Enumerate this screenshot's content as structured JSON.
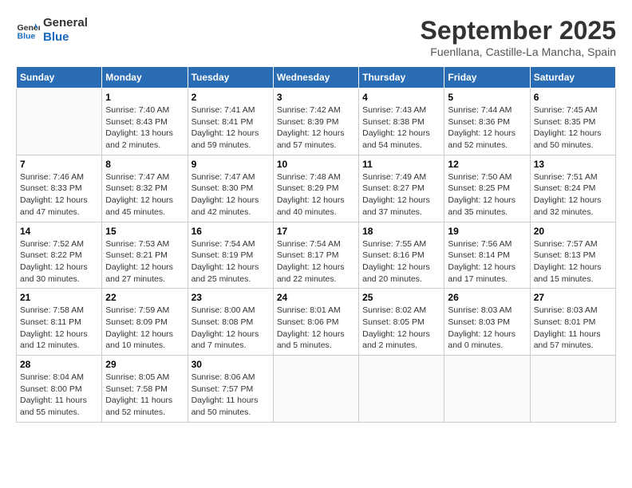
{
  "header": {
    "logo_line1": "General",
    "logo_line2": "Blue",
    "month": "September 2025",
    "location": "Fuenllana, Castille-La Mancha, Spain"
  },
  "weekdays": [
    "Sunday",
    "Monday",
    "Tuesday",
    "Wednesday",
    "Thursday",
    "Friday",
    "Saturday"
  ],
  "weeks": [
    [
      {
        "day": "",
        "info": ""
      },
      {
        "day": "1",
        "info": "Sunrise: 7:40 AM\nSunset: 8:43 PM\nDaylight: 13 hours\nand 2 minutes."
      },
      {
        "day": "2",
        "info": "Sunrise: 7:41 AM\nSunset: 8:41 PM\nDaylight: 12 hours\nand 59 minutes."
      },
      {
        "day": "3",
        "info": "Sunrise: 7:42 AM\nSunset: 8:39 PM\nDaylight: 12 hours\nand 57 minutes."
      },
      {
        "day": "4",
        "info": "Sunrise: 7:43 AM\nSunset: 8:38 PM\nDaylight: 12 hours\nand 54 minutes."
      },
      {
        "day": "5",
        "info": "Sunrise: 7:44 AM\nSunset: 8:36 PM\nDaylight: 12 hours\nand 52 minutes."
      },
      {
        "day": "6",
        "info": "Sunrise: 7:45 AM\nSunset: 8:35 PM\nDaylight: 12 hours\nand 50 minutes."
      }
    ],
    [
      {
        "day": "7",
        "info": "Sunrise: 7:46 AM\nSunset: 8:33 PM\nDaylight: 12 hours\nand 47 minutes."
      },
      {
        "day": "8",
        "info": "Sunrise: 7:47 AM\nSunset: 8:32 PM\nDaylight: 12 hours\nand 45 minutes."
      },
      {
        "day": "9",
        "info": "Sunrise: 7:47 AM\nSunset: 8:30 PM\nDaylight: 12 hours\nand 42 minutes."
      },
      {
        "day": "10",
        "info": "Sunrise: 7:48 AM\nSunset: 8:29 PM\nDaylight: 12 hours\nand 40 minutes."
      },
      {
        "day": "11",
        "info": "Sunrise: 7:49 AM\nSunset: 8:27 PM\nDaylight: 12 hours\nand 37 minutes."
      },
      {
        "day": "12",
        "info": "Sunrise: 7:50 AM\nSunset: 8:25 PM\nDaylight: 12 hours\nand 35 minutes."
      },
      {
        "day": "13",
        "info": "Sunrise: 7:51 AM\nSunset: 8:24 PM\nDaylight: 12 hours\nand 32 minutes."
      }
    ],
    [
      {
        "day": "14",
        "info": "Sunrise: 7:52 AM\nSunset: 8:22 PM\nDaylight: 12 hours\nand 30 minutes."
      },
      {
        "day": "15",
        "info": "Sunrise: 7:53 AM\nSunset: 8:21 PM\nDaylight: 12 hours\nand 27 minutes."
      },
      {
        "day": "16",
        "info": "Sunrise: 7:54 AM\nSunset: 8:19 PM\nDaylight: 12 hours\nand 25 minutes."
      },
      {
        "day": "17",
        "info": "Sunrise: 7:54 AM\nSunset: 8:17 PM\nDaylight: 12 hours\nand 22 minutes."
      },
      {
        "day": "18",
        "info": "Sunrise: 7:55 AM\nSunset: 8:16 PM\nDaylight: 12 hours\nand 20 minutes."
      },
      {
        "day": "19",
        "info": "Sunrise: 7:56 AM\nSunset: 8:14 PM\nDaylight: 12 hours\nand 17 minutes."
      },
      {
        "day": "20",
        "info": "Sunrise: 7:57 AM\nSunset: 8:13 PM\nDaylight: 12 hours\nand 15 minutes."
      }
    ],
    [
      {
        "day": "21",
        "info": "Sunrise: 7:58 AM\nSunset: 8:11 PM\nDaylight: 12 hours\nand 12 minutes."
      },
      {
        "day": "22",
        "info": "Sunrise: 7:59 AM\nSunset: 8:09 PM\nDaylight: 12 hours\nand 10 minutes."
      },
      {
        "day": "23",
        "info": "Sunrise: 8:00 AM\nSunset: 8:08 PM\nDaylight: 12 hours\nand 7 minutes."
      },
      {
        "day": "24",
        "info": "Sunrise: 8:01 AM\nSunset: 8:06 PM\nDaylight: 12 hours\nand 5 minutes."
      },
      {
        "day": "25",
        "info": "Sunrise: 8:02 AM\nSunset: 8:05 PM\nDaylight: 12 hours\nand 2 minutes."
      },
      {
        "day": "26",
        "info": "Sunrise: 8:03 AM\nSunset: 8:03 PM\nDaylight: 12 hours\nand 0 minutes."
      },
      {
        "day": "27",
        "info": "Sunrise: 8:03 AM\nSunset: 8:01 PM\nDaylight: 11 hours\nand 57 minutes."
      }
    ],
    [
      {
        "day": "28",
        "info": "Sunrise: 8:04 AM\nSunset: 8:00 PM\nDaylight: 11 hours\nand 55 minutes."
      },
      {
        "day": "29",
        "info": "Sunrise: 8:05 AM\nSunset: 7:58 PM\nDaylight: 11 hours\nand 52 minutes."
      },
      {
        "day": "30",
        "info": "Sunrise: 8:06 AM\nSunset: 7:57 PM\nDaylight: 11 hours\nand 50 minutes."
      },
      {
        "day": "",
        "info": ""
      },
      {
        "day": "",
        "info": ""
      },
      {
        "day": "",
        "info": ""
      },
      {
        "day": "",
        "info": ""
      }
    ]
  ]
}
